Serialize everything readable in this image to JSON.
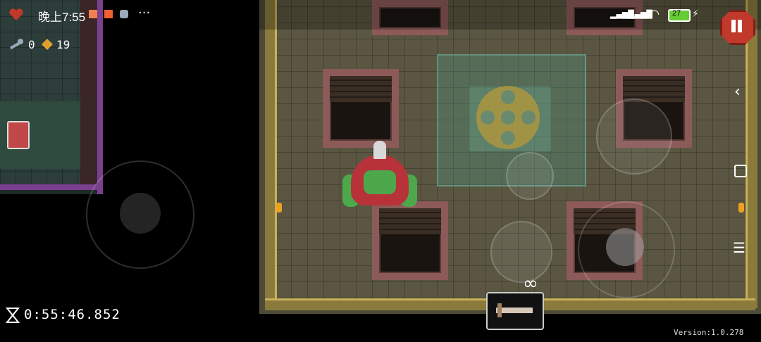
{
  "status_bar": {
    "time": "晚上7:55",
    "more": "···",
    "battery": "27"
  },
  "hud": {
    "ammo": "0",
    "coins": "19",
    "timer": "0:55:46.852",
    "weapon_energy": "∞",
    "version": "Version:1.0.278"
  },
  "colors": {
    "minimap_border": "#7a3f8f",
    "pause_button": "#c0392b",
    "hero_body": "#b8323a",
    "hero_skin": "#4ca84a",
    "pit_border": "#8c5a58"
  },
  "icons": {
    "health": "heart-icon",
    "ammo": "key-icon",
    "coins": "gem-icon",
    "timer": "hourglass-icon",
    "pause": "pause-icon",
    "back": "chevron-left-icon",
    "home": "square-icon",
    "menu": "menu-icon"
  }
}
